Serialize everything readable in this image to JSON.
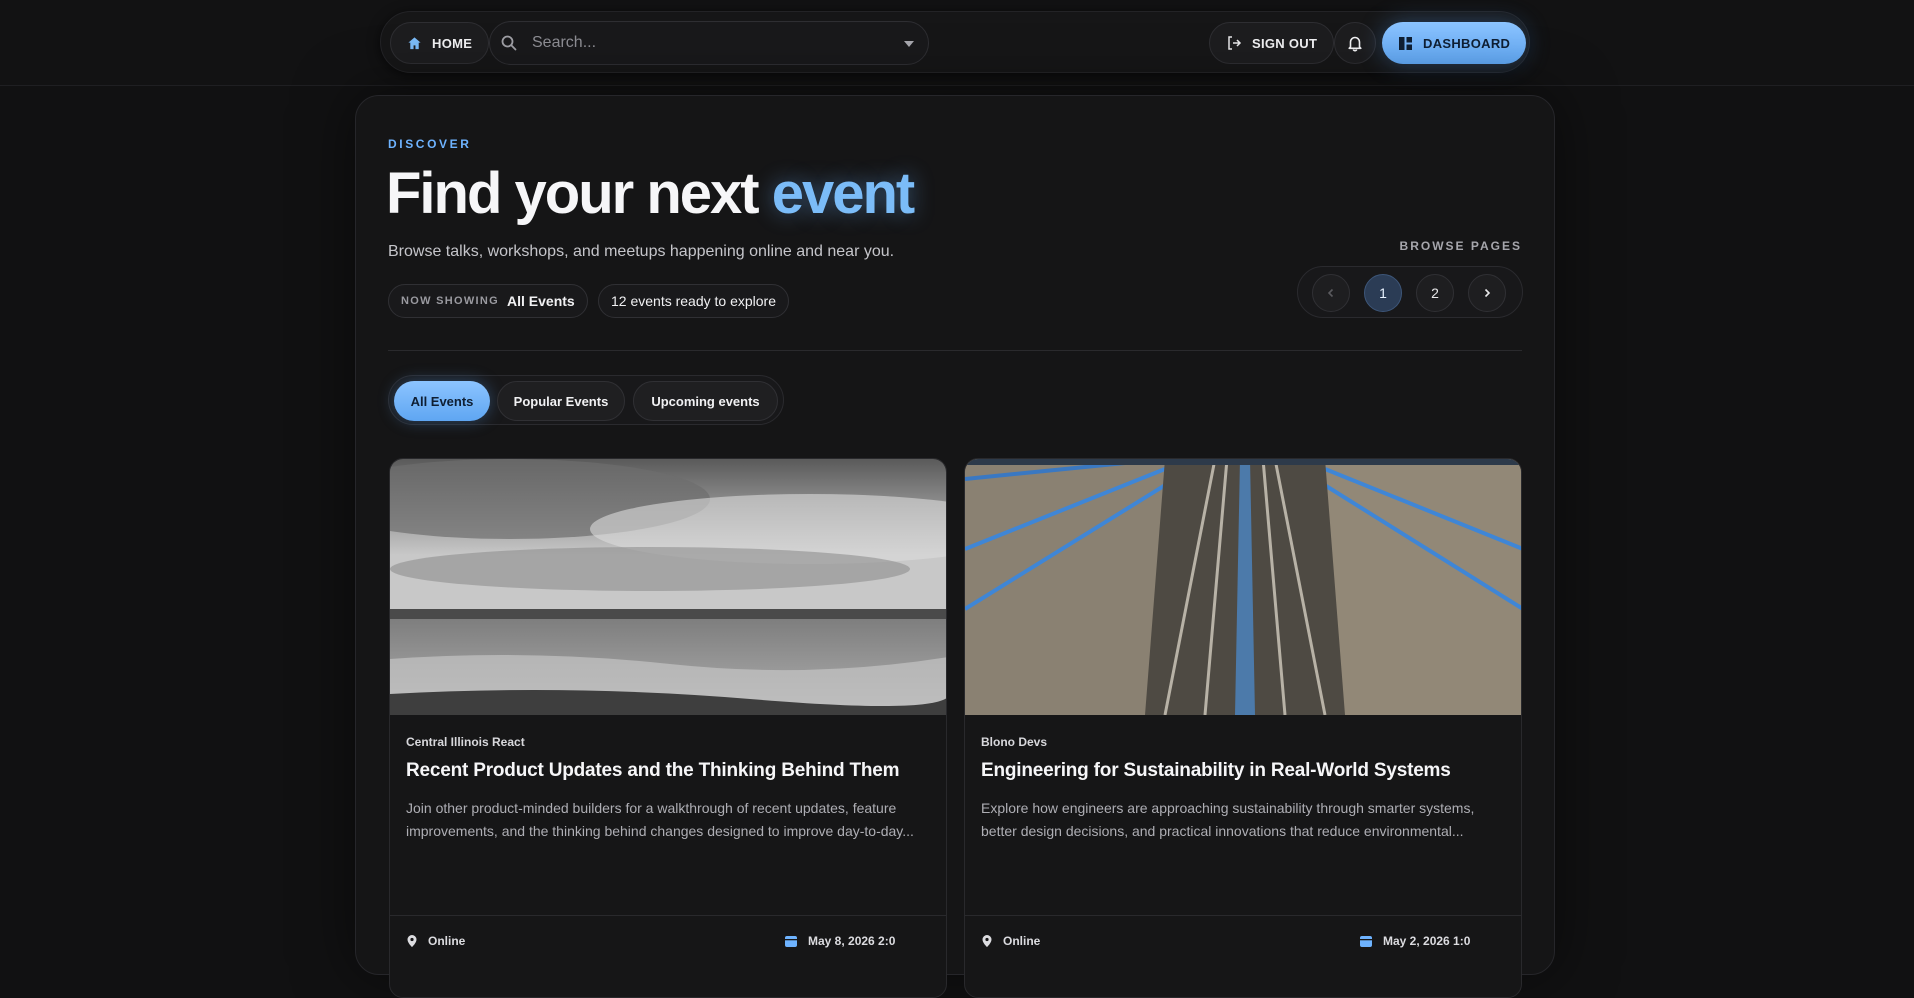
{
  "nav": {
    "home_label": "HOME",
    "search_placeholder": "Search...",
    "signout_label": "SIGN OUT",
    "dashboard_label": "DASHBOARD",
    "accent_color": "#6eb3ff"
  },
  "hero": {
    "eyebrow": "DISCOVER",
    "title_main": "Find your next",
    "title_accent": "event",
    "subtitle": "Browse talks, workshops, and meetups happening online and near you.",
    "showing_label": "NOW SHOWING",
    "showing_value": "All Events",
    "count_text": "12 events ready to explore"
  },
  "pagination": {
    "label": "BROWSE PAGES",
    "pages": [
      "1",
      "2"
    ],
    "current": "1"
  },
  "filters": {
    "tabs": [
      "All Events",
      "Popular Events",
      "Upcoming events"
    ],
    "active": "All Events"
  },
  "events": [
    {
      "organizer": "Central Illinois React",
      "title": "Recent Product Updates and the Thinking Behind Them",
      "description": "Join other product-minded builders for a walkthrough of recent updates, feature improvements, and the thinking behind changes designed to improve day-to-day...",
      "location": "Online",
      "date": "May 8, 2026 2:0"
    },
    {
      "organizer": "Blono Devs",
      "title": "Engineering for Sustainability in Real-World Systems",
      "description": "Explore how engineers are approaching sustainability through smarter systems, better design decisions, and practical innovations that reduce environmental...",
      "location": "Online",
      "date": "May 2, 2026 1:0"
    }
  ]
}
